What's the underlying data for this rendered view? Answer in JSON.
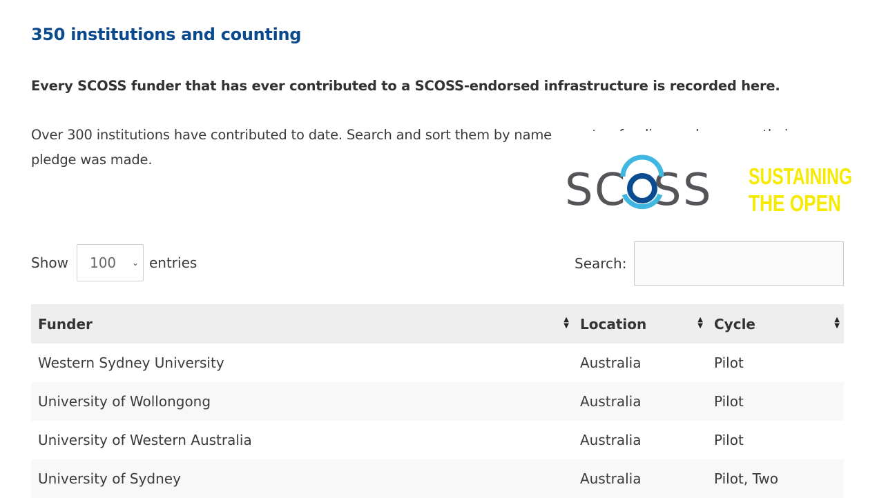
{
  "header": {
    "title": "350 institutions and counting",
    "lead": "Every SCOSS funder that has ever contributed to a SCOSS-endorsed infrastructure is recorded here.",
    "intro": "Over 300 institutions have contributed to date. Search and sort them by name, country, funding cycle or year their pledge was made."
  },
  "logo": {
    "wordmark": "SCOSS",
    "tagline_line1": "SUSTAINING",
    "tagline_line2": "THE OPEN",
    "colors": {
      "grey": "#555559",
      "light_blue": "#3fb7e0",
      "dark_blue": "#0b4b8f",
      "yellow": "#f5ea00"
    }
  },
  "controls": {
    "show_label": "Show",
    "entries_value": "100",
    "entries_label": "entries",
    "search_label": "Search:",
    "search_value": ""
  },
  "table": {
    "columns": [
      "Funder",
      "Location",
      "Cycle"
    ],
    "rows": [
      [
        "Western Sydney University",
        "Australia",
        "Pilot"
      ],
      [
        "University of Wollongong",
        "Australia",
        "Pilot"
      ],
      [
        "University of Western Australia",
        "Australia",
        "Pilot"
      ],
      [
        "University of Sydney",
        "Australia",
        "Pilot, Two"
      ]
    ]
  },
  "colors": {
    "heading": "#0a4a8c",
    "header_row": "#eeeeee"
  }
}
